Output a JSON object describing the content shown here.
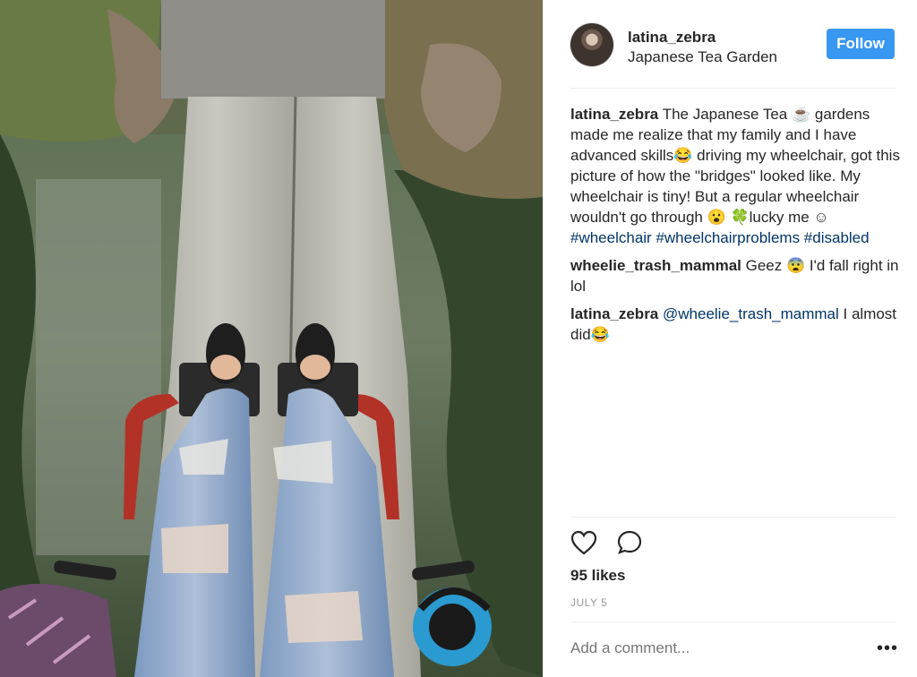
{
  "post": {
    "username": "latina_zebra",
    "location": "Japanese Tea Garden",
    "follow_label": "Follow"
  },
  "comments": [
    {
      "user": "latina_zebra",
      "text": "The Japanese Tea ☕ gardens made me realize that my family and I have advanced skills😂 driving my wheelchair, got this picture of how the \"bridges\" looked like. My wheelchair is tiny! But a regular wheelchair wouldn't go through 😮 🍀lucky me ☺",
      "hashtags": "#wheelchair #wheelchairproblems #disabled"
    },
    {
      "user": "wheelie_trash_mammal",
      "text": "Geez 😨 I'd fall right in lol"
    },
    {
      "user": "latina_zebra",
      "mention": "@wheelie_trash_mammal",
      "text": "I almost did😂"
    }
  ],
  "likes": "95 likes",
  "date": "JULY 5",
  "add_comment_placeholder": "Add a comment...",
  "icons": {
    "like": "heart-icon",
    "comment": "speech-bubble-icon",
    "more": "more-options-icon"
  },
  "colors": {
    "follow_button": "#3897f0",
    "hashtag": "#003569",
    "muted": "#999999",
    "text": "#262626"
  }
}
